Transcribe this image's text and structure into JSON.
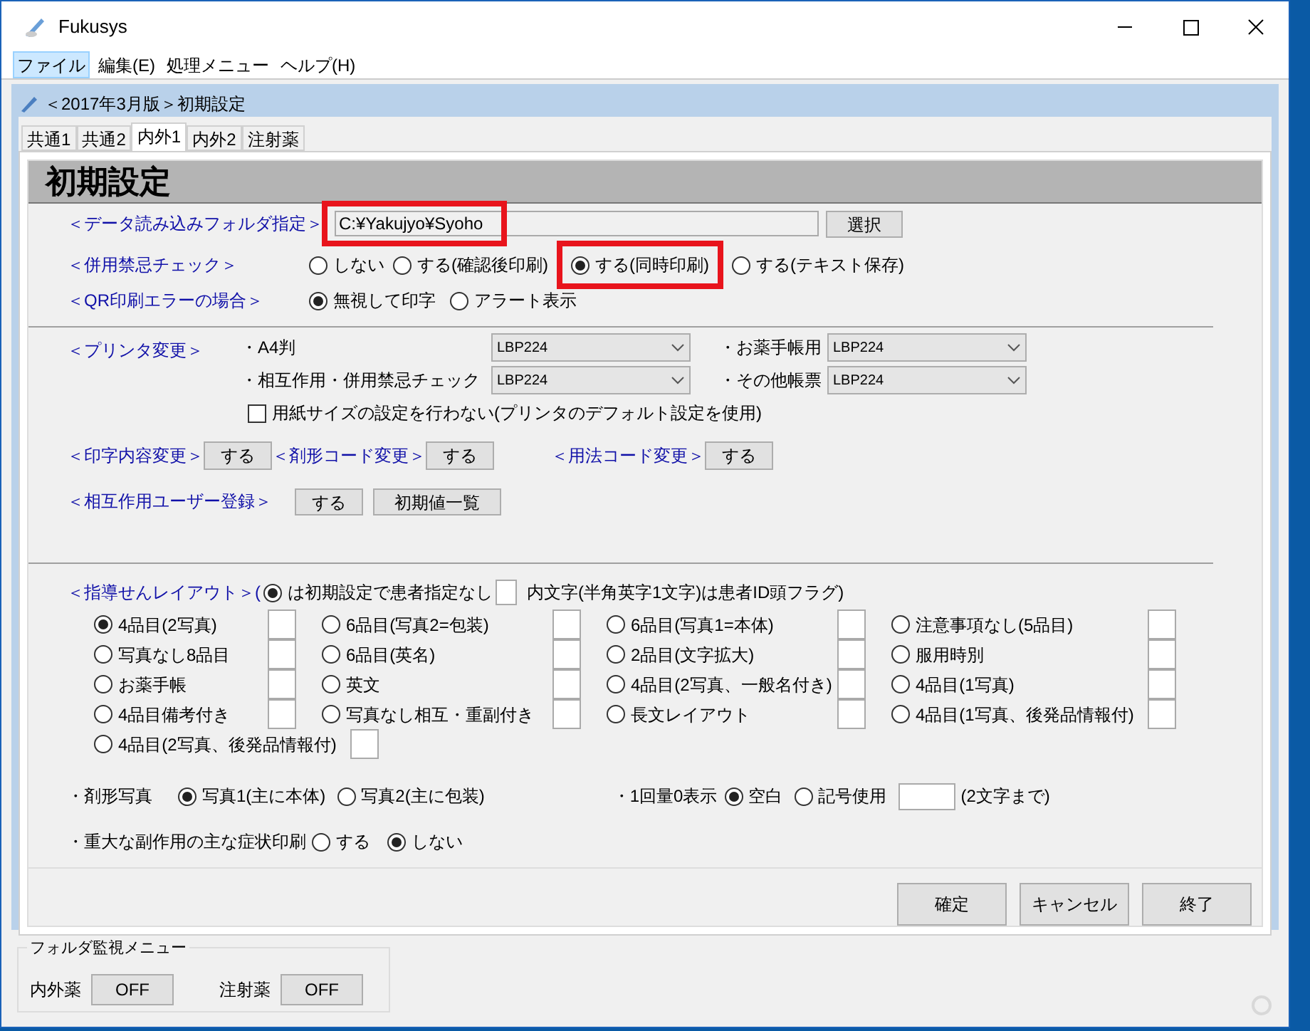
{
  "window": {
    "title": "Fukusys"
  },
  "menu": [
    {
      "label": "ファイル",
      "selected": true
    },
    {
      "label": "編集(E)",
      "selected": false
    },
    {
      "label": "処理メニュー",
      "selected": false
    },
    {
      "label": "ヘルプ(H)",
      "selected": false
    }
  ],
  "dialog": {
    "title": "＜2017年3月版＞初期設定"
  },
  "tabs": [
    {
      "label": "共通1",
      "selected": false
    },
    {
      "label": "共通2",
      "selected": false
    },
    {
      "label": "内外1",
      "selected": true
    },
    {
      "label": "内外2",
      "selected": false
    },
    {
      "label": "注射薬",
      "selected": false
    }
  ],
  "heading": "初期設定",
  "folder": {
    "label": "＜データ読み込みフォルダ指定＞",
    "value": "C:¥Yakujyo¥Syoho",
    "highlighted": true,
    "button": "選択"
  },
  "interaction_check": {
    "label": "＜併用禁忌チェック＞",
    "options": [
      {
        "label": "しない",
        "selected": false,
        "highlighted": false
      },
      {
        "label": "する(確認後印刷)",
        "selected": false,
        "highlighted": false
      },
      {
        "label": "する(同時印刷)",
        "selected": true,
        "highlighted": true
      },
      {
        "label": "する(テキスト保存)",
        "selected": false,
        "highlighted": false
      }
    ]
  },
  "qr_error": {
    "label": "＜QR印刷エラーの場合＞",
    "options": [
      {
        "label": "無視して印字",
        "selected": true
      },
      {
        "label": "アラート表示",
        "selected": false
      }
    ]
  },
  "printer": {
    "label": "＜プリンタ変更＞",
    "selects": [
      {
        "label": "・A4判",
        "value": "LBP224"
      },
      {
        "label": "・お薬手帳用",
        "value": "LBP224"
      },
      {
        "label": "・相互作用・併用禁忌チェック",
        "value": "LBP224"
      },
      {
        "label": "・その他帳票",
        "value": "LBP224"
      }
    ],
    "checkbox": {
      "label": "用紙サイズの設定を行わない(プリンタのデフォルト設定を使用)",
      "checked": false
    }
  },
  "code_changes": [
    {
      "label": "＜印字内容変更＞",
      "button": "する"
    },
    {
      "label": "＜剤形コード変更＞",
      "button": "する"
    },
    {
      "label": "＜用法コード変更＞",
      "button": "する"
    }
  ],
  "interaction_user": {
    "label": "＜相互作用ユーザー登録＞",
    "buttons": [
      "する",
      "初期値一覧"
    ]
  },
  "layout": {
    "label": "＜指導せんレイアウト＞(",
    "default_option": {
      "label": "は初期設定で患者指定なし",
      "selected": true
    },
    "flag_note": "内文字(半角英字1文字)は患者ID頭フラグ)",
    "options": [
      {
        "label": "4品目(2写真)",
        "selected": true
      },
      {
        "label": "6品目(写真2=包装)",
        "selected": false
      },
      {
        "label": "6品目(写真1=本体)",
        "selected": false
      },
      {
        "label": "注意事項なし(5品目)",
        "selected": false
      },
      {
        "label": "写真なし8品目",
        "selected": false
      },
      {
        "label": "6品目(英名)",
        "selected": false
      },
      {
        "label": "2品目(文字拡大)",
        "selected": false
      },
      {
        "label": "服用時別",
        "selected": false
      },
      {
        "label": "お薬手帳",
        "selected": false
      },
      {
        "label": "英文",
        "selected": false
      },
      {
        "label": "4品目(2写真、一般名付き)",
        "selected": false
      },
      {
        "label": "4品目(1写真)",
        "selected": false
      },
      {
        "label": "4品目備考付き",
        "selected": false
      },
      {
        "label": "写真なし相互・重副付き",
        "selected": false
      },
      {
        "label": "長文レイアウト",
        "selected": false
      },
      {
        "label": "4品目(1写真、後発品情報付)",
        "selected": false
      },
      {
        "label": "4品目(2写真、後発品情報付)",
        "selected": false
      }
    ]
  },
  "photo": {
    "label": "・剤形写真",
    "options": [
      {
        "label": "写真1(主に本体)",
        "selected": true
      },
      {
        "label": "写真2(主に包装)",
        "selected": false
      }
    ]
  },
  "zero_display": {
    "label": "・1回量0表示",
    "options": [
      {
        "label": "空白",
        "selected": true
      },
      {
        "label": "記号使用",
        "selected": false
      }
    ],
    "note": "(2文字まで)"
  },
  "side_effect": {
    "label": "・重大な副作用の主な症状印刷",
    "options": [
      {
        "label": "する",
        "selected": false
      },
      {
        "label": "しない",
        "selected": true
      }
    ]
  },
  "footer_buttons": [
    "確定",
    "キャンセル",
    "終了"
  ],
  "folder_monitor": {
    "title": "フォルダ監視メニュー",
    "items": [
      {
        "label": "内外薬",
        "button": "OFF"
      },
      {
        "label": "注射薬",
        "button": "OFF"
      }
    ]
  }
}
